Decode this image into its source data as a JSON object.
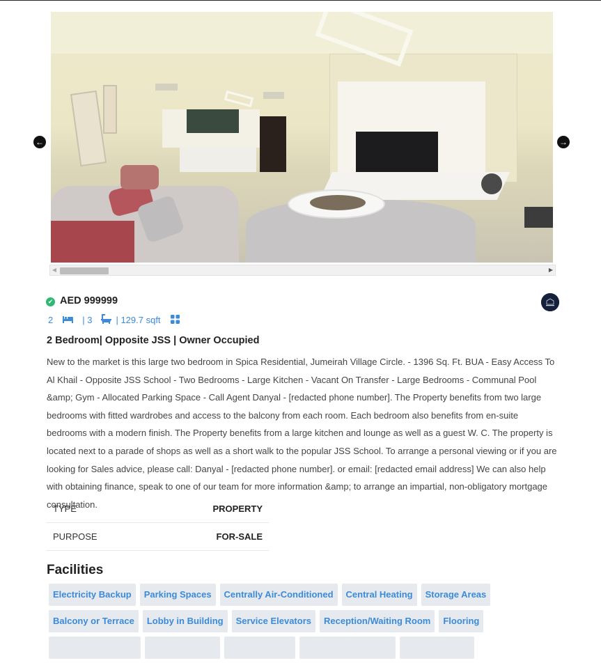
{
  "carousel": {
    "prev_icon": "arrow-left-icon",
    "next_icon": "arrow-right-icon",
    "prev_glyph": "←",
    "next_glyph": "→"
  },
  "listing": {
    "verified_glyph": "✔",
    "price": "AED 999999",
    "bedrooms": "2",
    "bathrooms": "| 3",
    "area": "| 129.7 sqft",
    "title": "2 Bedroom| Opposite JSS | Owner Occupied",
    "description": "New to the market is this large two bedroom in Spica Residential, Jumeirah Village Circle. - 1396 Sq. Ft. BUA - Easy Access To Al Khail - Opposite JSS School - Two Bedrooms - Large Kitchen - Vacant On Transfer - Large Bedrooms - Communal Pool &amp; Gym - Allocated Parking Space - Call Agent Danyal - [redacted phone number]. The Property benefits from two large bedrooms with fitted wardrobes and access to the balcony from each room. Each bedroom also benefits from en-suite bedrooms with a modern finish. The Property benefits from a large kitchen and lounge as well as a guest W. C. The property is located next to a parade of shops as well as a short walk to the popular JSS School. To arrange a personal viewing or if you are looking for Sales advice, please call: Danyal - [redacted phone number]. or email: [redacted email address] We can also help with obtaining finance, speak to one of our team for more information &amp; to arrange an impartial, non-obligatory mortgage consultation."
  },
  "details": [
    {
      "key": "TYPE",
      "value": "PROPERTY"
    },
    {
      "key": "PURPOSE",
      "value": "FOR-SALE"
    }
  ],
  "facilities": {
    "heading": "Facilities",
    "row1": [
      "Electricity Backup",
      "Parking Spaces",
      "Centrally Air-Conditioned",
      "Central Heating",
      "Storage Areas"
    ],
    "row2": [
      "Balcony or Terrace",
      "Lobby in Building",
      "Service Elevators",
      "Reception/Waiting Room",
      "Flooring"
    ]
  },
  "colors": {
    "accent": "#3b8bd9",
    "verified": "#2eb872",
    "tag_bg": "#e6e9ee"
  }
}
